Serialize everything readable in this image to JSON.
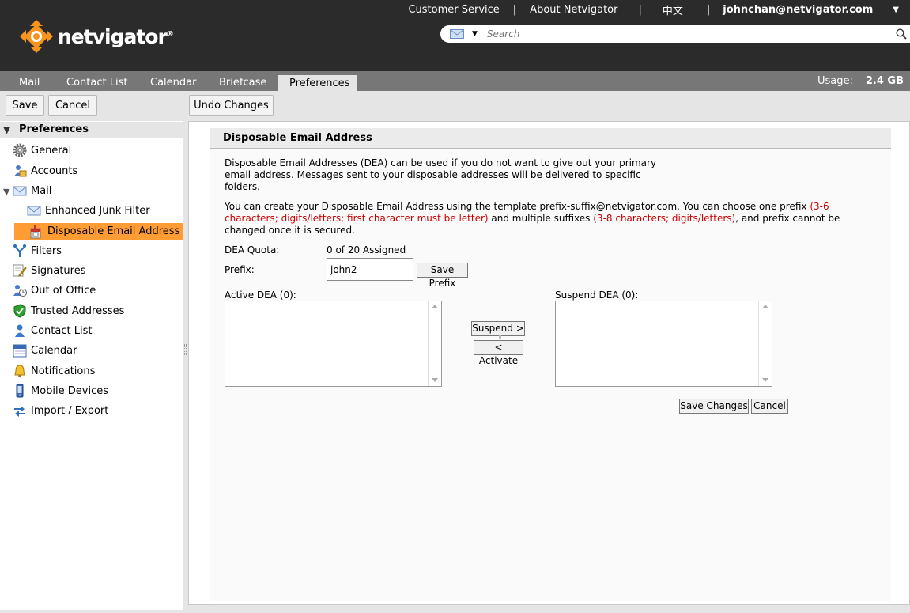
{
  "header": {
    "logo_text": "netvigator",
    "logo_reg": "®",
    "links": [
      "Customer Service",
      "About Netvigator",
      "中文"
    ],
    "user": "johnchan@netvigator.com",
    "search_placeholder": "Search"
  },
  "nav": {
    "tabs": [
      "Mail",
      "Contact List",
      "Calendar",
      "Briefcase",
      "Preferences"
    ],
    "active_tab": "Preferences",
    "usage_label": "Usage:",
    "usage_value": "2.4 GB"
  },
  "toolbar": {
    "save_label": "Save",
    "cancel_label": "Cancel",
    "undo_label": "Undo Changes"
  },
  "sidebar": {
    "header": "Preferences",
    "items": [
      {
        "label": "General",
        "icon": "gear-icon"
      },
      {
        "label": "Accounts",
        "icon": "accounts-icon"
      },
      {
        "label": "Mail",
        "icon": "mail-icon"
      },
      {
        "label": "Enhanced Junk Filter",
        "icon": "envelope-icon"
      },
      {
        "label": "Disposable Email Address",
        "icon": "mailbox-icon"
      },
      {
        "label": "Filters",
        "icon": "filter-icon"
      },
      {
        "label": "Signatures",
        "icon": "signature-icon"
      },
      {
        "label": "Out of Office",
        "icon": "out-of-office-icon"
      },
      {
        "label": "Trusted Addresses",
        "icon": "shield-icon"
      },
      {
        "label": "Contact List",
        "icon": "contact-icon"
      },
      {
        "label": "Calendar",
        "icon": "calendar-icon"
      },
      {
        "label": "Notifications",
        "icon": "bell-icon"
      },
      {
        "label": "Mobile Devices",
        "icon": "mobile-icon"
      },
      {
        "label": "Import / Export",
        "icon": "import-export-icon"
      }
    ],
    "selected": "Disposable Email Address"
  },
  "content": {
    "title": "Disposable Email Address",
    "intro_line1": "Disposable Email Addresses (DEA) can be used if you do not want to give out your primary",
    "intro_line2": "email address. Messages sent to your disposable addresses will be delivered to specific",
    "intro_line3": "folders.",
    "template_a": "You can create your Disposable Email Address using the template prefix-suffix@netvigator.com. You can choose one prefix ",
    "template_red1a": "(3-6",
    "template_red1b": "characters; digits/letters; first character must be letter)",
    "template_b": " and multiple suffixes ",
    "template_red2": "(3-8 characters; digits/letters)",
    "template_c": ", and prefix cannot be",
    "template_d": "changed once it is secured.",
    "quota_label": "DEA Quota:",
    "quota_value": "0 of 20 Assigned",
    "prefix_label": "Prefix:",
    "prefix_value": "john2",
    "save_prefix_label": "Save Prefix",
    "active_label": "Active DEA (0):",
    "suspend_label": "Suspend DEA (0):",
    "suspend_btn": "Suspend >",
    "activate_btn": "< Activate",
    "save_changes_btn": "Save Changes",
    "cancel_btn": "Cancel"
  },
  "colors": {
    "header_bg": "#2b2b2b",
    "nav_bg": "#777777",
    "selected_bg": "#ff9c33",
    "warning_red": "#cc0000",
    "logo_orange": "#f7941d"
  }
}
